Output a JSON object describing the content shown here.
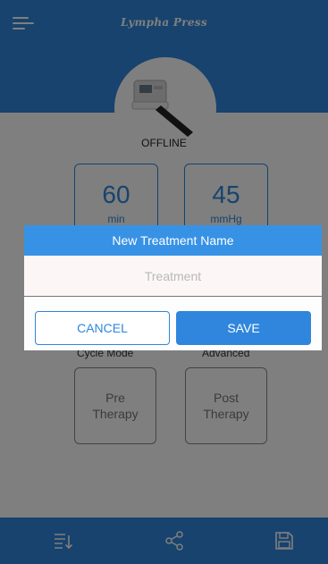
{
  "header": {
    "brand": "Lympha Press",
    "menu_icon": "hamburger-menu-icon"
  },
  "device": {
    "status": "OFFLINE",
    "image": "pump-device-image"
  },
  "settings": {
    "time": {
      "value": "60",
      "unit": "min"
    },
    "pressure": {
      "value": "45",
      "unit": "mmHg"
    },
    "cycle_mode_label": "Cycle Mode",
    "advanced_label": "Advanced",
    "pre_therapy": "Pre Therapy",
    "post_therapy": "Post Therapy"
  },
  "bottom_nav": {
    "icons": [
      "list-sort-icon",
      "share-icon",
      "save-disk-icon"
    ]
  },
  "dialog": {
    "title": "New Treatment Name",
    "input_placeholder": "Treatment",
    "input_value": "",
    "cancel_label": "CANCEL",
    "save_label": "SAVE"
  },
  "colors": {
    "primary": "#2f86dc",
    "dialog_header": "#3792e6",
    "overlay": "rgba(0,0,0,0.5)"
  }
}
